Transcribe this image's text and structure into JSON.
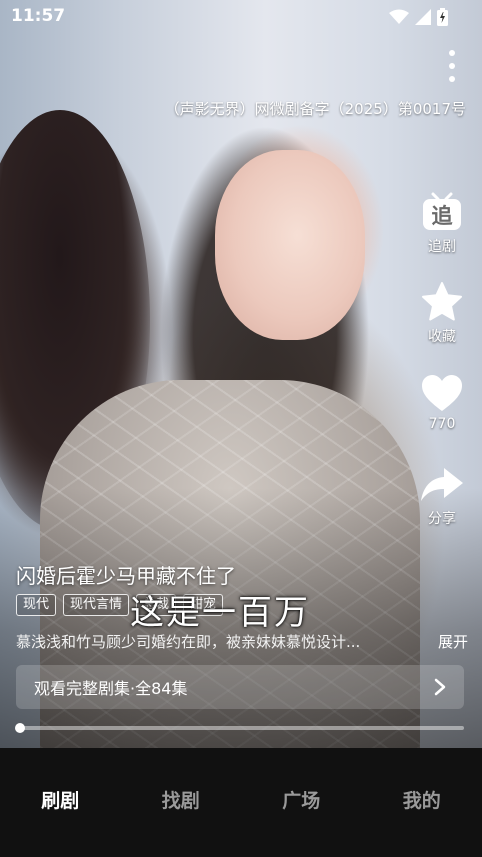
{
  "status_bar": {
    "time": "11:57"
  },
  "player": {
    "license_text": "（声影无界）网微剧备字（2025）第0017号",
    "subtitle_caption": "这是一百万",
    "progress_fraction": 0.01
  },
  "side_actions": [
    {
      "id": "follow",
      "icon": "follow-drama-icon",
      "label": "追剧"
    },
    {
      "id": "favorite",
      "icon": "star-icon",
      "label": "收藏"
    },
    {
      "id": "like",
      "icon": "heart-icon",
      "label": "770"
    },
    {
      "id": "share",
      "icon": "share-arrow-icon",
      "label": "分享"
    }
  ],
  "follow_badge": "追",
  "drama": {
    "title": "闪婚后霍少马甲藏不住了",
    "tags": [
      "现代",
      "现代言情",
      "总裁",
      "甜宠"
    ],
    "synopsis": "慕浅浅和竹马顾少司婚约在即，被亲妹妹慕悦设计...",
    "expand_label": "展开",
    "episodes_label": "观看完整剧集·全84集"
  },
  "bottom_nav": [
    {
      "label": "刷剧",
      "active": true
    },
    {
      "label": "找剧",
      "active": false
    },
    {
      "label": "广场",
      "active": false
    },
    {
      "label": "我的",
      "active": false
    }
  ],
  "colors": {
    "nav_background": "#111111",
    "nav_inactive": "#9a9a9a",
    "accent": "#ffffff"
  }
}
